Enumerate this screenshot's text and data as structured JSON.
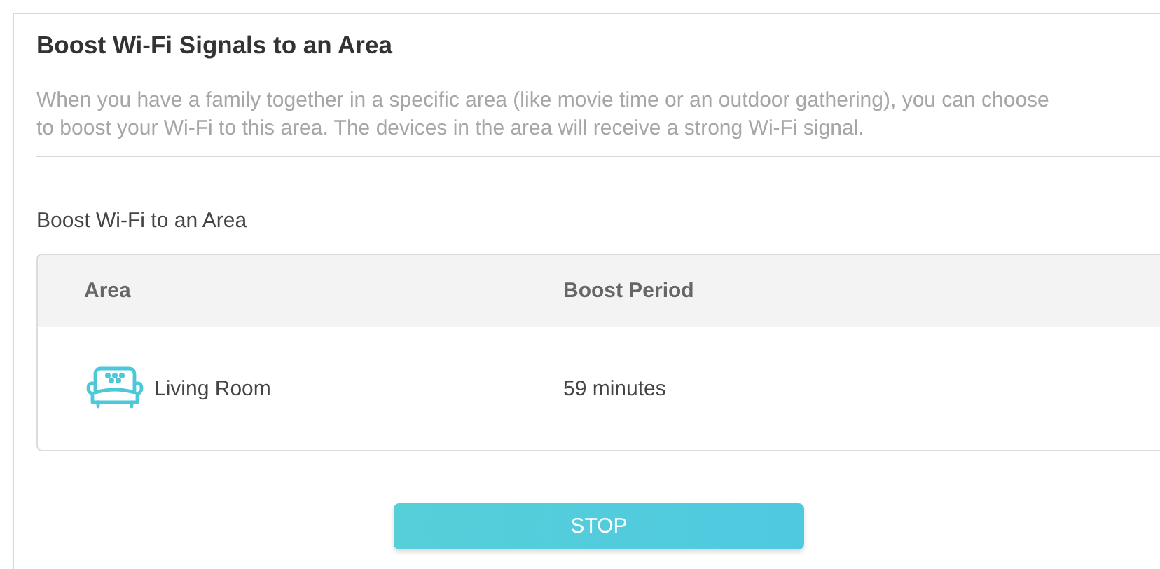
{
  "title": "Boost Wi-Fi Signals to an Area",
  "description": "When you have a family together in a specific area (like movie time or an outdoor gathering), you can choose to boost your Wi-Fi to this area. The devices in the area will receive a strong Wi-Fi signal.",
  "section_label": "Boost Wi-Fi to an Area",
  "table": {
    "columns": [
      "Area",
      "Boost Period"
    ],
    "rows": [
      {
        "area": "Living Room",
        "period": "59 minutes"
      }
    ]
  },
  "button": "STOP"
}
